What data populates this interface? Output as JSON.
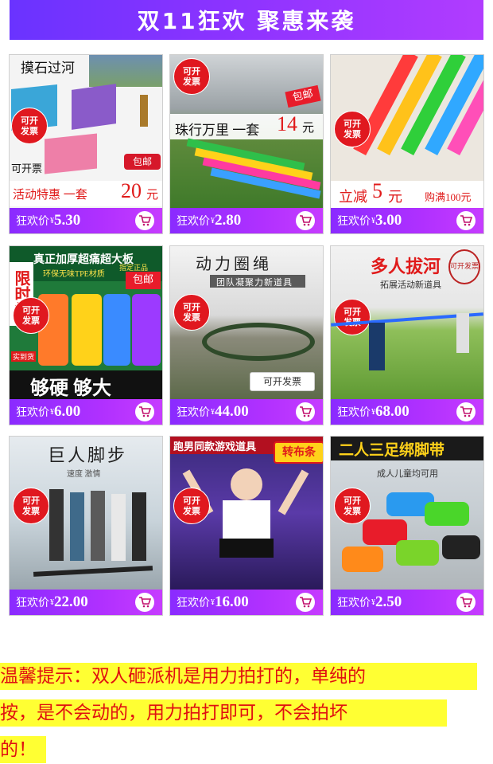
{
  "banner": {
    "title": "双11狂欢 聚惠来袭"
  },
  "colors": {
    "price_bar": "#9b30ff",
    "badge": "#e0181f",
    "tip_text": "#e01010",
    "tip_bg": "#ffff33"
  },
  "products": [
    {
      "price_label": "狂欢价",
      "currency": "¥",
      "price": "5.30",
      "title": "摸石过河",
      "badge": "可开\n发票",
      "note": "可开票",
      "promo": "活动特惠  一套",
      "promo_price": "20",
      "promo_unit": "元",
      "tag": "包邮"
    },
    {
      "price_label": "狂欢价",
      "currency": "¥",
      "price": "2.80",
      "badge": "可开\n发票",
      "title": "珠行万里 一套",
      "promo_price": "14",
      "promo_unit": "元",
      "tag": "包邮"
    },
    {
      "price_label": "狂欢价",
      "currency": "¥",
      "price": "3.00",
      "badge": "可开\n发票",
      "promo": "立减",
      "promo_price": "5",
      "promo_unit": "元",
      "extra": "购满100元"
    },
    {
      "price_label": "狂欢价",
      "currency": "¥",
      "price": "6.00",
      "badge": "可开\n发票",
      "title": "真正加厚超痛超大板",
      "subtitle": "环保无味TPE材质",
      "tag": "包邮",
      "side": "限时抢",
      "note": "指定正品",
      "slogan": "够硬 够大",
      "corner": "实到货"
    },
    {
      "price_label": "狂欢价",
      "currency": "¥",
      "price": "44.00",
      "badge": "可开\n发票",
      "title": "动力圈绳",
      "subtitle": "团队凝聚力新道具",
      "note": "可开发票"
    },
    {
      "price_label": "狂欢价",
      "currency": "¥",
      "price": "68.00",
      "badge": "可开\n发票",
      "title": "多人拔河",
      "subtitle": "拓展活动新道具",
      "corner": "可开发票"
    },
    {
      "price_label": "狂欢价",
      "currency": "¥",
      "price": "22.00",
      "badge": "可开\n发票",
      "title": "巨人脚步",
      "subtitle": "速度 激情"
    },
    {
      "price_label": "狂欢价",
      "currency": "¥",
      "price": "16.00",
      "badge": "可开\n发票",
      "title": "跑男同款游戏道具",
      "tag": "转布条"
    },
    {
      "price_label": "狂欢价",
      "currency": "¥",
      "price": "2.50",
      "badge": "可开\n发票",
      "title": "二人三足绑脚带",
      "subtitle": "成人儿童均可用"
    }
  ],
  "tip": {
    "line1": "温馨提示：双人砸派机是用力拍打的，单纯的",
    "line2": "按，是不会动的，用力拍打即可，不会拍坏",
    "line3": "的！"
  }
}
